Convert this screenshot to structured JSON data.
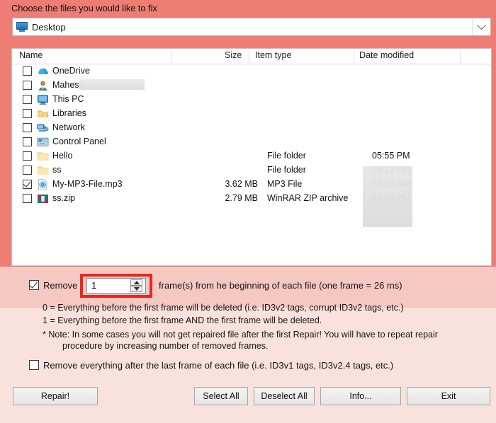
{
  "dialog": {
    "title": "Choose the files you would like to fix",
    "accent_red": "#e8271b",
    "background_top": "#ee7d73",
    "background_bottom": "#f9e2dd"
  },
  "location_combo": {
    "value": "Desktop",
    "icon": "monitor-icon",
    "arrow_icon": "chevron-down-icon"
  },
  "file_list": {
    "columns": [
      "Name",
      "Size",
      "Item type",
      "Date modified"
    ],
    "rows": [
      {
        "name": "OneDrive",
        "icon": "onedrive-cloud-icon",
        "checked": false,
        "size": "",
        "type": "",
        "date": ""
      },
      {
        "name": "Mahesh",
        "icon": "user-account-icon",
        "checked": false,
        "size": "",
        "type": "",
        "date": "",
        "redacted_name": true
      },
      {
        "name": "This PC",
        "icon": "this-pc-monitor-icon",
        "checked": false,
        "size": "",
        "type": "",
        "date": ""
      },
      {
        "name": "Libraries",
        "icon": "libraries-folder-icon",
        "checked": false,
        "size": "",
        "type": "",
        "date": ""
      },
      {
        "name": "Network",
        "icon": "network-icon",
        "checked": false,
        "size": "",
        "type": "",
        "date": ""
      },
      {
        "name": "Control Panel",
        "icon": "control-panel-icon",
        "checked": false,
        "size": "",
        "type": "",
        "date": ""
      },
      {
        "name": "Hello",
        "icon": "folder-icon",
        "checked": false,
        "size": "",
        "type": "File folder",
        "date": "05:55 PM"
      },
      {
        "name": "ss",
        "icon": "folder-icon",
        "checked": false,
        "size": "",
        "type": "File folder",
        "date": "08:19 PM"
      },
      {
        "name": "My-MP3-File.mp3",
        "icon": "mp3-file-icon",
        "checked": true,
        "size": "3.62 MB",
        "type": "MP3 File",
        "date": "06:53 PM"
      },
      {
        "name": "ss.zip",
        "icon": "winrar-zip-icon",
        "checked": false,
        "size": "2.79 MB",
        "type": "WinRAR ZIP archive",
        "date": "07:46 PM"
      }
    ]
  },
  "remove_frames": {
    "checked": true,
    "label_before": "Remove",
    "spinner_value": "1",
    "label_after": "frame(s) from he beginning of each file (one frame = 26 ms)",
    "spin_up_icon": "triangle-up-icon",
    "spin_down_icon": "triangle-down-icon"
  },
  "explanations": [
    "0 = Everything before the first frame will be deleted (i.e. ID3v2 tags, corrupt ID3v2 tags, etc.)",
    "1 = Everything before the first frame AND the first frame will be deleted.",
    "* Note: In some cases you will not get repaired file after the first Repair! You will have to repeat repair",
    "procedure by increasing number of removed frames."
  ],
  "remove_last_frame": {
    "checked": false,
    "label": "Remove everything after the last frame of each file (i.e. ID3v1 tags, ID3v2.4 tags, etc.)"
  },
  "buttons": {
    "repair": "Repair!",
    "select_all": "Select All",
    "deselect_all": "Deselect All",
    "info": "Info...",
    "exit": "Exit"
  }
}
